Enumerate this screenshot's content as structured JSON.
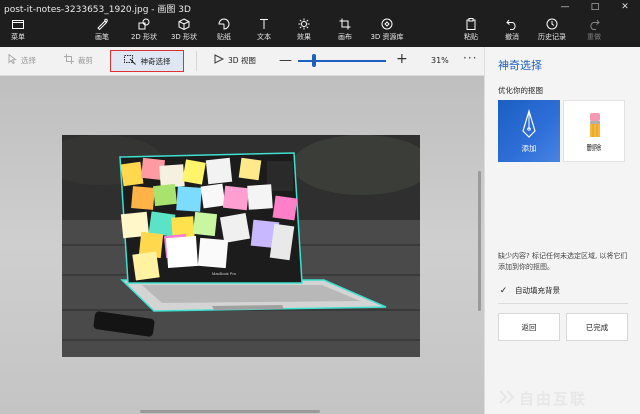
{
  "window": {
    "title": "post-it-notes-3233653_1920.jpg - 画图 3D",
    "controls": [
      "—",
      "□",
      "✕"
    ]
  },
  "ribbon": {
    "menu": "菜单",
    "brushes": "画笔",
    "shapes2d": "2D 形状",
    "shapes3d": "3D 形状",
    "stickers": "贴纸",
    "text": "文本",
    "effects": "效果",
    "canvas": "画布",
    "library3d": "3D 资源库",
    "paste": "粘贴",
    "undo": "撤消",
    "history": "历史记录",
    "redo": "重做"
  },
  "toolbar": {
    "select": "选择",
    "crop": "裁剪",
    "magic_select": "神奇选择",
    "view3d": "3D 视图",
    "zoom_minus": "—",
    "zoom_plus": "+",
    "zoom": "31%",
    "more": "···"
  },
  "panel": {
    "title": "神奇选择",
    "subtitle": "优化你的抠图",
    "add_label": "添加",
    "remove_label": "删除",
    "hint": "缺少内容? 标记任何未选定区域, 以将它们添加到你的抠图。",
    "autofill_label": "自动填充背景",
    "autofill_checked": true,
    "back_button": "返回",
    "done_button": "已完成"
  },
  "photo": {
    "screen_text": "MacBook Pro"
  },
  "watermark": {
    "text": "自由互联"
  },
  "colors": {
    "accent": "#1f5fbf",
    "highlight_border": "#e03030",
    "ribbon_bg": "#1e1e1e",
    "selection_outline": "#3fe0d0"
  }
}
